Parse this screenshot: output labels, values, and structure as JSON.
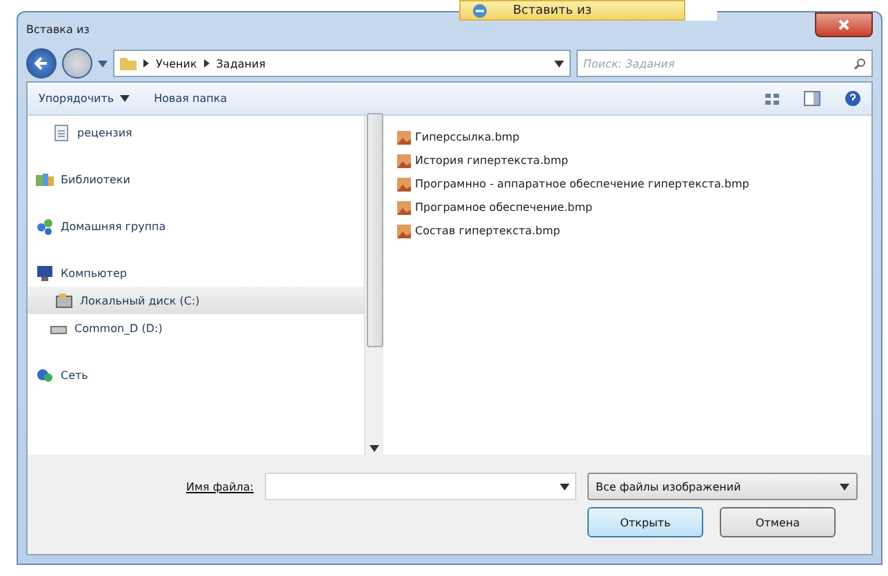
{
  "popup_menu": {
    "item": "Вставить из"
  },
  "window": {
    "title": "Вставка из"
  },
  "nav": {
    "path": [
      "Ученик",
      "Задания"
    ],
    "search_placeholder": "Поиск: Задания"
  },
  "toolbar": {
    "organize": "Упорядочить",
    "new_folder": "Новая папка"
  },
  "sidebar": {
    "items": [
      {
        "label": "рецензия",
        "kind": "document",
        "selected": false
      },
      {
        "label": "Библиотеки",
        "kind": "library",
        "selected": false
      },
      {
        "label": "Домашняя группа",
        "kind": "homegroup",
        "selected": false
      },
      {
        "label": "Компьютер",
        "kind": "computer",
        "selected": false,
        "children": [
          {
            "label": "Локальный диск (C:)",
            "kind": "disk",
            "selected": true
          },
          {
            "label": "Common_D (D:)",
            "kind": "drive",
            "selected": false
          }
        ]
      },
      {
        "label": "Сеть",
        "kind": "network",
        "selected": false
      }
    ]
  },
  "files": [
    "Гиперссылка.bmp",
    "История гипертекста.bmp",
    "Програмнно - аппаратное обеспечение гипертекста.bmp",
    "Програмное обеспечение.bmp",
    "Состав гипертекста.bmp"
  ],
  "footer": {
    "filename_label": "Имя файла:",
    "filter": "Все файлы изображений",
    "buttons": [
      {
        "label": "Открыть",
        "default": true
      },
      {
        "label": "Отмена",
        "default": false
      }
    ]
  }
}
